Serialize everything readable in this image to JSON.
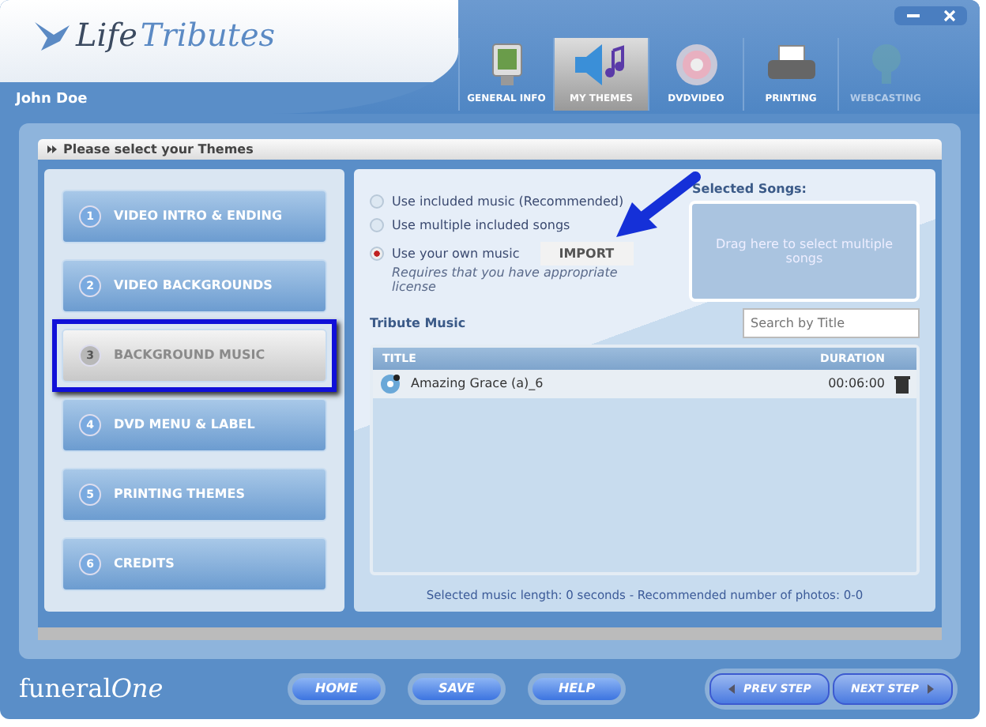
{
  "brand": {
    "word_1": "Life",
    "word_2": "Tributes"
  },
  "user": "John Doe",
  "tabs": [
    {
      "label": "GENERAL INFO",
      "selected": false,
      "disabled": false
    },
    {
      "label": "MY THEMES",
      "selected": true,
      "disabled": false
    },
    {
      "label": "DVDVIDEO",
      "selected": false,
      "disabled": false
    },
    {
      "label": "PRINTING",
      "selected": false,
      "disabled": false
    },
    {
      "label": "WEBCASTING",
      "selected": false,
      "disabled": true
    }
  ],
  "panel_title": "Please select your Themes",
  "themes": [
    {
      "number": "1",
      "label": "VIDEO INTRO & ENDING",
      "selected": false,
      "highlighted": false
    },
    {
      "number": "2",
      "label": "VIDEO BACKGROUNDS",
      "selected": false,
      "highlighted": false
    },
    {
      "number": "3",
      "label": "BACKGROUND MUSIC",
      "selected": true,
      "highlighted": true
    },
    {
      "number": "4",
      "label": "DVD MENU & LABEL",
      "selected": false,
      "highlighted": false
    },
    {
      "number": "5",
      "label": "PRINTING THEMES",
      "selected": false,
      "highlighted": false
    },
    {
      "number": "6",
      "label": "CREDITS",
      "selected": false,
      "highlighted": false
    }
  ],
  "music_options": [
    {
      "label": "Use included music (Recommended)",
      "selected": false
    },
    {
      "label": "Use multiple included songs",
      "selected": false
    },
    {
      "label": "Use your own music",
      "selected": true,
      "note": "Requires that you have appropriate license"
    }
  ],
  "import_button": "IMPORT",
  "selected_songs": {
    "title": "Selected Songs:",
    "drop_hint": "Drag here to select multiple songs"
  },
  "tribute_music": {
    "title": "Tribute Music",
    "search": {
      "placeholder": "Search by Title"
    },
    "columns": [
      "TITLE",
      "DURATION"
    ],
    "rows": [
      {
        "title": "Amazing Grace (a)_6",
        "duration": "00:06:00"
      }
    ]
  },
  "summary": "Selected music length: 0 seconds  -  Recommended number of photos: 0-0",
  "footer": {
    "logo": [
      "funeral",
      "One"
    ],
    "buttons": [
      "HOME",
      "SAVE",
      "HELP"
    ],
    "steps": [
      "PREV STEP",
      "NEXT STEP"
    ]
  }
}
